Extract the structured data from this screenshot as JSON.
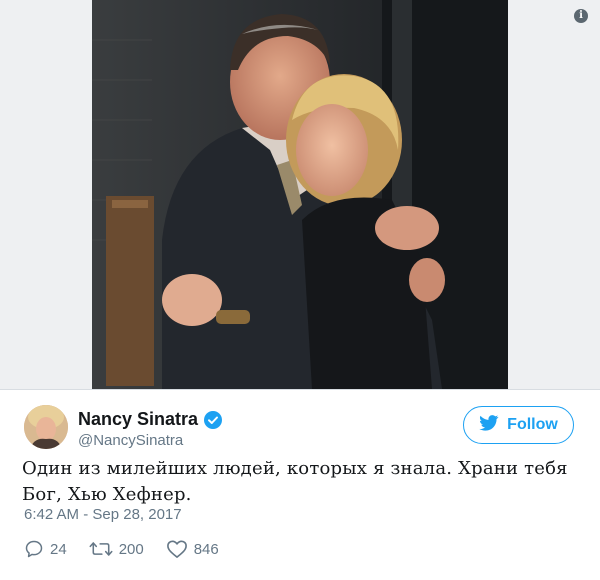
{
  "info_icon": "info-icon",
  "photo": {
    "icon": "photo-image"
  },
  "tweet": {
    "display_name": "Nancy Sinatra",
    "handle": "@NancySinatra",
    "verified_icon": "verified-badge-icon",
    "follow_label": "Follow",
    "follow_icon": "twitter-bird-icon",
    "text": "Один из милейших людей, которых я знала. Храни тебя Бог, Хью Хефнер.",
    "timestamp": "6:42 AM - Sep 28, 2017"
  },
  "actions": {
    "reply_count": "24",
    "retweet_count": "200",
    "like_count": "846"
  },
  "colors": {
    "accent": "#1da1f2",
    "text": "#14171a",
    "muted": "#657786"
  }
}
